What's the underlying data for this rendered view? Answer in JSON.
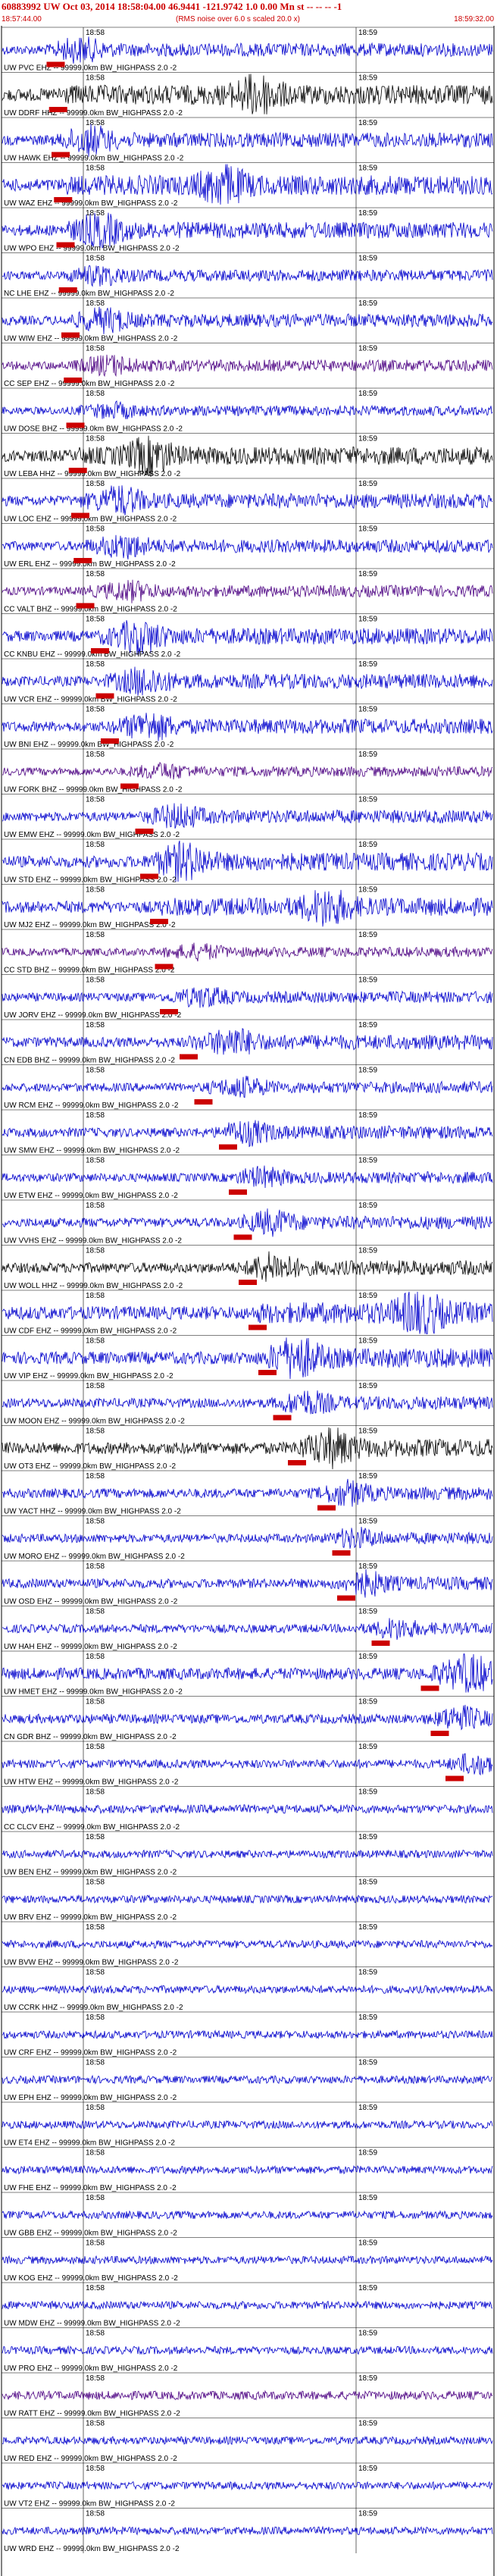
{
  "header": {
    "title": "60883992 UW Oct 03, 2014 18:58:04.00   46.9441 -121.9742  1.0 0.00 Mn st -- -- --  -1",
    "start_time": "18:57:44.00",
    "note": "(RMS noise over 6.0 s scaled 20.0 x)",
    "end_time": "18:59:32.00"
  },
  "colors": {
    "pick": "#cc0000",
    "header_text": "#cc0000",
    "grid": "#000000",
    "trace_black": "#000000",
    "trace_blue": "#0000cc",
    "trace_purple": "#4b0082"
  },
  "chart_data": {
    "type": "line",
    "title": "60883992 UW Oct 03, 2014 18:58:04.00   46.9441 -121.9742  1.0 0.00 Mn st -- -- --  -1",
    "xlabel": "",
    "ylabel": "",
    "xlim": [
      "18:57:44.00",
      "18:59:32.00"
    ],
    "x_ticks": [
      "18:58",
      "18:59"
    ],
    "grid": true,
    "series": [
      {
        "name": "UW PVC EHZ -- 99999.0km BW_HIGHPASS 2.0 -2",
        "color": "blue",
        "pick_fraction": 0.11,
        "peak_fraction": 0.16,
        "amplitude": 0.5
      },
      {
        "name": "UW DDRF HHZ -- 99999.0km BW_HIGHPASS 2.0 -2",
        "color": "black",
        "pick_fraction": 0.115,
        "peak_fraction": 0.52,
        "amplitude": 0.9
      },
      {
        "name": "UW HAWK EHZ -- 99999.0km BW_HIGHPASS 2.0 -2",
        "color": "blue",
        "pick_fraction": 0.12,
        "peak_fraction": 0.18,
        "amplitude": 0.6
      },
      {
        "name": "UW WAZ EHZ -- 99999.0km BW_HIGHPASS 2.0 -2",
        "color": "blue",
        "pick_fraction": 0.125,
        "peak_fraction": 0.45,
        "amplitude": 0.9
      },
      {
        "name": "UW WPO EHZ -- 99999.0km BW_HIGHPASS 2.0 -2",
        "color": "blue",
        "pick_fraction": 0.13,
        "peak_fraction": 0.2,
        "amplitude": 0.7
      },
      {
        "name": "NC LHE EHZ -- 99999.0km BW_HIGHPASS 2.0 -2",
        "color": "blue",
        "pick_fraction": 0.135,
        "peak_fraction": 0.2,
        "amplitude": 0.4
      },
      {
        "name": "UW WIW EHZ -- 99999.0km BW_HIGHPASS 2.0 -2",
        "color": "blue",
        "pick_fraction": 0.14,
        "peak_fraction": 0.21,
        "amplitude": 0.5
      },
      {
        "name": "CC SEP EHZ -- 99999.0km BW_HIGHPASS 2.0 -2",
        "color": "purple",
        "pick_fraction": 0.145,
        "peak_fraction": 0.22,
        "amplitude": 0.4
      },
      {
        "name": "UW DOSE BHZ -- 99999.0km BW_HIGHPASS 2.0 -2",
        "color": "blue",
        "pick_fraction": 0.15,
        "peak_fraction": 0.23,
        "amplitude": 0.3
      },
      {
        "name": "UW LEBA HHZ -- 99999.0km BW_HIGHPASS 2.0 -2",
        "color": "black",
        "pick_fraction": 0.155,
        "peak_fraction": 0.3,
        "amplitude": 0.8
      },
      {
        "name": "UW LOC EHZ -- 99999.0km BW_HIGHPASS 2.0 -2",
        "color": "blue",
        "pick_fraction": 0.16,
        "peak_fraction": 0.24,
        "amplitude": 0.6
      },
      {
        "name": "UW ERL EHZ -- 99999.0km BW_HIGHPASS 2.0 -2",
        "color": "blue",
        "pick_fraction": 0.165,
        "peak_fraction": 0.25,
        "amplitude": 0.5
      },
      {
        "name": "CC VALT BHZ -- 99999.0km BW_HIGHPASS 2.0 -2",
        "color": "purple",
        "pick_fraction": 0.17,
        "peak_fraction": 0.26,
        "amplitude": 0.4
      },
      {
        "name": "CC KNBU EHZ -- 99999.0km BW_HIGHPASS 2.0 -2",
        "color": "blue",
        "pick_fraction": 0.2,
        "peak_fraction": 0.28,
        "amplitude": 0.7
      },
      {
        "name": "UW VCR EHZ -- 99999.0km BW_HIGHPASS 2.0 -2",
        "color": "blue",
        "pick_fraction": 0.21,
        "peak_fraction": 0.29,
        "amplitude": 0.6
      },
      {
        "name": "UW BNI EHZ -- 99999.0km BW_HIGHPASS 2.0 -2",
        "color": "blue",
        "pick_fraction": 0.22,
        "peak_fraction": 0.3,
        "amplitude": 0.6
      },
      {
        "name": "UW FORK BHZ -- 99999.0km BW_HIGHPASS 2.0 -2",
        "color": "purple",
        "pick_fraction": 0.26,
        "peak_fraction": 0.33,
        "amplitude": 0.3
      },
      {
        "name": "UW EMW EHZ -- 99999.0km BW_HIGHPASS 2.0 -2",
        "color": "blue",
        "pick_fraction": 0.29,
        "peak_fraction": 0.36,
        "amplitude": 0.5
      },
      {
        "name": "UW STD EHZ -- 99999.0km BW_HIGHPASS 2.0 -2",
        "color": "blue",
        "pick_fraction": 0.3,
        "peak_fraction": 0.37,
        "amplitude": 0.8
      },
      {
        "name": "UW MJ2 EHZ -- 99999.0km BW_HIGHPASS 2.0 -2",
        "color": "blue",
        "pick_fraction": 0.32,
        "peak_fraction": 0.66,
        "amplitude": 0.8
      },
      {
        "name": "CC STD BHZ -- 99999.0km BW_HIGHPASS 2.0 -2",
        "color": "purple",
        "pick_fraction": 0.33,
        "peak_fraction": 0.4,
        "amplitude": 0.3
      },
      {
        "name": "UW JORV EHZ -- 99999.0km BW_HIGHPASS 2.0 -2",
        "color": "blue",
        "pick_fraction": 0.34,
        "peak_fraction": 0.41,
        "amplitude": 0.4
      },
      {
        "name": "CN EDB BHZ -- 99999.0km BW_HIGHPASS 2.0 -2",
        "color": "blue",
        "pick_fraction": 0.38,
        "peak_fraction": 0.47,
        "amplitude": 0.6
      },
      {
        "name": "UW RCM EHZ -- 99999.0km BW_HIGHPASS 2.0 -2",
        "color": "blue",
        "pick_fraction": 0.41,
        "peak_fraction": 0.49,
        "amplitude": 0.4
      },
      {
        "name": "UW SMW EHZ -- 99999.0km BW_HIGHPASS 2.0 -2",
        "color": "blue",
        "pick_fraction": 0.46,
        "peak_fraction": 0.5,
        "amplitude": 0.5
      },
      {
        "name": "UW ETW EHZ -- 99999.0km BW_HIGHPASS 2.0 -2",
        "color": "blue",
        "pick_fraction": 0.48,
        "peak_fraction": 0.53,
        "amplitude": 0.4
      },
      {
        "name": "UW VVHS EHZ -- 99999.0km BW_HIGHPASS 2.0 -2",
        "color": "blue",
        "pick_fraction": 0.49,
        "peak_fraction": 0.55,
        "amplitude": 0.5
      },
      {
        "name": "UW WOLL HHZ -- 99999.0km BW_HIGHPASS 2.0 -2",
        "color": "black",
        "pick_fraction": 0.5,
        "peak_fraction": 0.55,
        "amplitude": 0.6
      },
      {
        "name": "UW CDF EHZ -- 99999.0km BW_HIGHPASS 2.0 -2",
        "color": "blue",
        "pick_fraction": 0.52,
        "peak_fraction": 0.85,
        "amplitude": 1.0
      },
      {
        "name": "UW VIP EHZ -- 99999.0km BW_HIGHPASS 2.0 -2",
        "color": "blue",
        "pick_fraction": 0.54,
        "peak_fraction": 0.6,
        "amplitude": 0.9
      },
      {
        "name": "UW MOON EHZ -- 99999.0km BW_HIGHPASS 2.0 -2",
        "color": "blue",
        "pick_fraction": 0.57,
        "peak_fraction": 0.62,
        "amplitude": 0.5
      },
      {
        "name": "UW OT3 EHZ -- 99999.0km BW_HIGHPASS 2.0 -2",
        "color": "black",
        "pick_fraction": 0.6,
        "peak_fraction": 0.67,
        "amplitude": 0.8
      },
      {
        "name": "UW YACT HHZ -- 99999.0km BW_HIGHPASS 2.0 -2",
        "color": "blue",
        "pick_fraction": 0.66,
        "peak_fraction": 0.7,
        "amplitude": 0.5
      },
      {
        "name": "UW MORO EHZ -- 99999.0km BW_HIGHPASS 2.0 -2",
        "color": "blue",
        "pick_fraction": 0.69,
        "peak_fraction": 0.72,
        "amplitude": 0.4
      },
      {
        "name": "UW OSD EHZ -- 99999.0km BW_HIGHPASS 2.0 -2",
        "color": "blue",
        "pick_fraction": 0.7,
        "peak_fraction": 0.74,
        "amplitude": 0.5
      },
      {
        "name": "UW HAH EHZ -- 99999.0km BW_HIGHPASS 2.0 -2",
        "color": "blue",
        "pick_fraction": 0.77,
        "peak_fraction": 0.8,
        "amplitude": 0.4
      },
      {
        "name": "UW HMET EHZ -- 99999.0km BW_HIGHPASS 2.0 -2",
        "color": "blue",
        "pick_fraction": 0.87,
        "peak_fraction": 0.95,
        "amplitude": 0.8
      },
      {
        "name": "CN GDR BHZ -- 99999.0km BW_HIGHPASS 2.0 -2",
        "color": "blue",
        "pick_fraction": 0.89,
        "peak_fraction": 0.93,
        "amplitude": 0.5
      },
      {
        "name": "UW HTW EHZ -- 99999.0km BW_HIGHPASS 2.0 -2",
        "color": "blue",
        "pick_fraction": 0.92,
        "peak_fraction": 0.96,
        "amplitude": 0.4
      },
      {
        "name": "CC CLCV EHZ -- 99999.0km BW_HIGHPASS 2.0 -2",
        "color": "blue",
        "pick_fraction": null,
        "peak_fraction": null,
        "amplitude": 0.4
      },
      {
        "name": "UW BEN EHZ -- 99999.0km BW_HIGHPASS 2.0 -2",
        "color": "blue",
        "pick_fraction": null,
        "peak_fraction": null,
        "amplitude": 0.3
      },
      {
        "name": "UW BRV EHZ -- 99999.0km BW_HIGHPASS 2.0 -2",
        "color": "blue",
        "pick_fraction": null,
        "peak_fraction": null,
        "amplitude": 0.3
      },
      {
        "name": "UW BVW EHZ -- 99999.0km BW_HIGHPASS 2.0 -2",
        "color": "blue",
        "pick_fraction": null,
        "peak_fraction": null,
        "amplitude": 0.3
      },
      {
        "name": "UW CCRK HHZ -- 99999.0km BW_HIGHPASS 2.0 -2",
        "color": "blue",
        "pick_fraction": null,
        "peak_fraction": null,
        "amplitude": 0.3
      },
      {
        "name": "UW CRF EHZ -- 99999.0km BW_HIGHPASS 2.0 -2",
        "color": "blue",
        "pick_fraction": null,
        "peak_fraction": null,
        "amplitude": 0.3
      },
      {
        "name": "UW EPH EHZ -- 99999.0km BW_HIGHPASS 2.0 -2",
        "color": "blue",
        "pick_fraction": null,
        "peak_fraction": null,
        "amplitude": 0.3
      },
      {
        "name": "UW ET4 EHZ -- 99999.0km BW_HIGHPASS 2.0 -2",
        "color": "blue",
        "pick_fraction": null,
        "peak_fraction": null,
        "amplitude": 0.3
      },
      {
        "name": "UW FHE EHZ -- 99999.0km BW_HIGHPASS 2.0 -2",
        "color": "blue",
        "pick_fraction": null,
        "peak_fraction": null,
        "amplitude": 0.3
      },
      {
        "name": "UW GBB EHZ -- 99999.0km BW_HIGHPASS 2.0 -2",
        "color": "blue",
        "pick_fraction": null,
        "peak_fraction": null,
        "amplitude": 0.3
      },
      {
        "name": "UW KOG EHZ -- 99999.0km BW_HIGHPASS 2.0 -2",
        "color": "blue",
        "pick_fraction": null,
        "peak_fraction": null,
        "amplitude": 0.3
      },
      {
        "name": "UW MDW EHZ -- 99999.0km BW_HIGHPASS 2.0 -2",
        "color": "blue",
        "pick_fraction": null,
        "peak_fraction": null,
        "amplitude": 0.3
      },
      {
        "name": "UW PRO EHZ -- 99999.0km BW_HIGHPASS 2.0 -2",
        "color": "blue",
        "pick_fraction": null,
        "peak_fraction": null,
        "amplitude": 0.3
      },
      {
        "name": "UW RATT EHZ -- 99999.0km BW_HIGHPASS 2.0 -2",
        "color": "purple",
        "pick_fraction": null,
        "peak_fraction": null,
        "amplitude": 0.4
      },
      {
        "name": "UW RED EHZ -- 99999.0km BW_HIGHPASS 2.0 -2",
        "color": "blue",
        "pick_fraction": null,
        "peak_fraction": null,
        "amplitude": 0.3
      },
      {
        "name": "UW VT2 EHZ -- 99999.0km BW_HIGHPASS 2.0 -2",
        "color": "blue",
        "pick_fraction": null,
        "peak_fraction": null,
        "amplitude": 0.3
      },
      {
        "name": "UW WRD EHZ -- 99999.0km BW_HIGHPASS 2.0 -2",
        "color": "blue",
        "pick_fraction": null,
        "peak_fraction": null,
        "amplitude": 0.3
      }
    ]
  }
}
